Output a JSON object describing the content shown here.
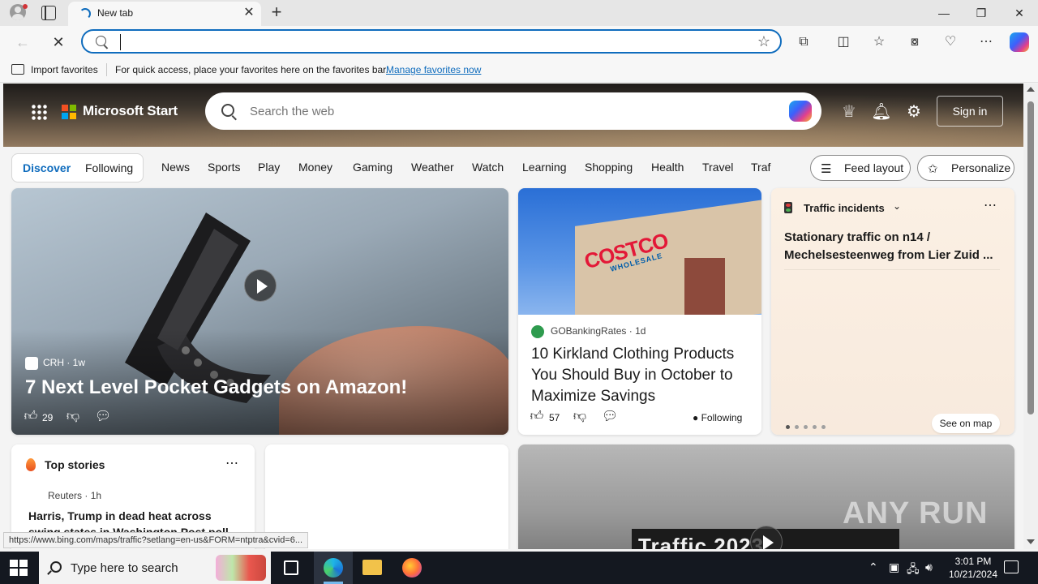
{
  "browser": {
    "tab_title": "New tab",
    "address_value": "",
    "favorites_bar": {
      "import_label": "Import favorites",
      "message": "For quick access, place your favorites here on the favorites bar.",
      "manage_link": "Manage favorites now"
    },
    "status_url": "https://www.bing.com/maps/traffic?setlang=en-us&FORM=ntptra&cvid=6..."
  },
  "page": {
    "brand": "Microsoft Start",
    "search_placeholder": "Search the web",
    "sign_in": "Sign in",
    "feed_tabs": [
      "Discover",
      "Following"
    ],
    "categories": [
      "News",
      "Sports",
      "Play",
      "Money",
      "Gaming",
      "Weather",
      "Watch",
      "Learning",
      "Shopping",
      "Health",
      "Travel",
      "Traf"
    ],
    "feed_layout": "Feed layout",
    "personalize": "Personalize",
    "cards": {
      "main": {
        "source": "CRH",
        "age": "1w",
        "title": "7 Next Level Pocket Gadgets on Amazon!",
        "likes": "29"
      },
      "costco": {
        "sign_text": "COSTCO",
        "sign_subtext": "WHOLESALE",
        "source": "GOBankingRates",
        "age": "1d",
        "title": "10 Kirkland Clothing Products You Should Buy in October to Maximize Savings",
        "likes": "57",
        "following": "Following"
      },
      "traffic": {
        "header": "Traffic incidents",
        "description": "Stationary traffic on n14 / Mechelsesteenweg from Lier Zuid ...",
        "see_map": "See on map"
      },
      "top_stories": {
        "header": "Top stories",
        "source": "Reuters",
        "age": "1h",
        "title": "Harris, Trump in dead heat across swing states in Washington Post poll"
      },
      "video": {
        "overlay_text": "Traffic 2023",
        "watermark": "ANY RUN"
      }
    }
  },
  "taskbar": {
    "search_placeholder": "Type here to search",
    "time": "3:01 PM",
    "date": "10/21/2024"
  },
  "colors": {
    "accent": "#0f6cbd",
    "taskbar": "#141820",
    "ms_red": "#f25022",
    "ms_green": "#7fba00",
    "ms_blue": "#00a4ef",
    "ms_yellow": "#ffb900"
  }
}
